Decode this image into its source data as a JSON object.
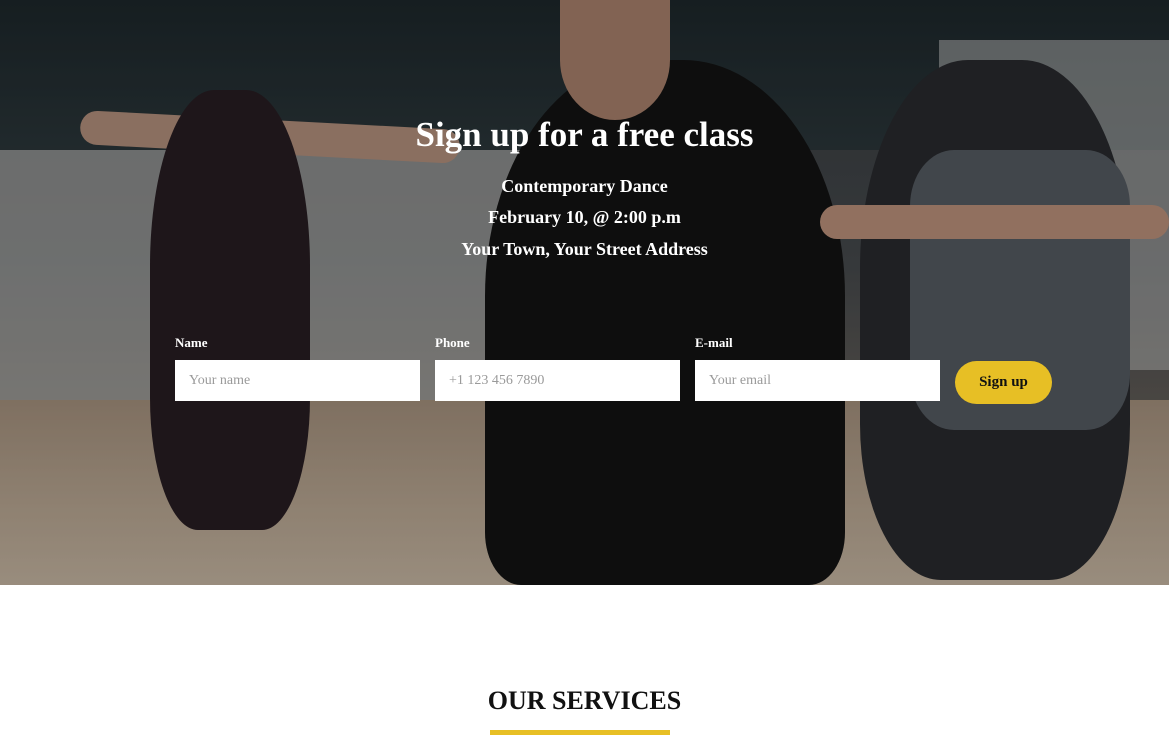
{
  "hero": {
    "title": "Sign up for a free class",
    "class_name": "Contemporary Dance",
    "date": "February 10, @ 2:00 p.m",
    "address": "Your Town, Your Street Address"
  },
  "form": {
    "name_label": "Name",
    "name_placeholder": "Your name",
    "phone_label": "Phone",
    "phone_placeholder": "+1 123 456 7890",
    "email_label": "E-mail",
    "email_placeholder": "Your email",
    "submit_label": "Sign up"
  },
  "services": {
    "title": "OUR SERVICES"
  },
  "colors": {
    "accent": "#e7bf25"
  }
}
